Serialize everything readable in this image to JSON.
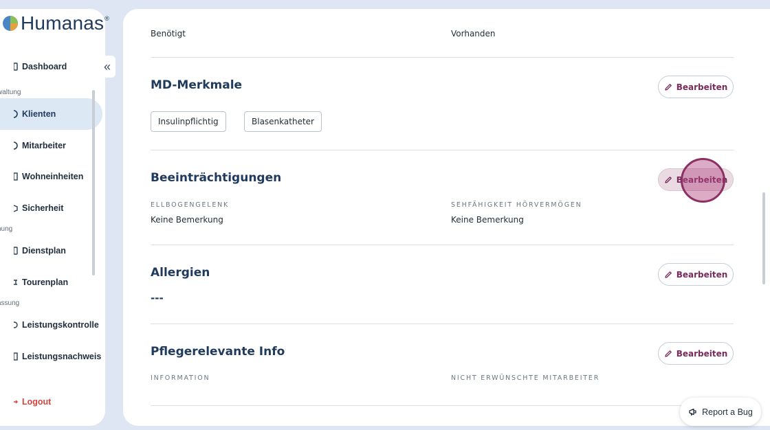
{
  "sidebar": {
    "logo_text": "Humanas",
    "logo_reg": "®",
    "collapse_glyph": "«",
    "sections": [
      "waltung",
      "nung",
      "assung"
    ],
    "items": [
      {
        "label": "Dashboard",
        "icon": "dashboard-icon"
      },
      {
        "label": "Klienten",
        "icon": "clients-icon",
        "active": true
      },
      {
        "label": "Mitarbeiter",
        "icon": "staff-icon"
      },
      {
        "label": "Wohneinheiten",
        "icon": "housing-icon"
      },
      {
        "label": "Sicherheit",
        "icon": "security-icon"
      },
      {
        "label": "Dienstplan",
        "icon": "schedule-icon"
      },
      {
        "label": "Tourenplan",
        "icon": "route-icon"
      },
      {
        "label": "Leistungskontrolle",
        "icon": "control-icon"
      },
      {
        "label": "Leistungsnachweis",
        "icon": "proof-icon"
      }
    ],
    "logout_label": "Logout"
  },
  "main": {
    "top_row": {
      "left": "Benötigt",
      "right": "Vorhanden"
    },
    "md_merkmale": {
      "title": "MD-Merkmale",
      "edit_label": "Bearbeiten",
      "tags": [
        "Insulinpflichtig",
        "Blasenkatheter"
      ]
    },
    "beeintraechtigungen": {
      "title": "Beeinträchtigungen",
      "edit_label": "Bearbeiten",
      "fields": [
        {
          "label": "ELLBOGENGELENK",
          "value": "Keine Bemerkung"
        },
        {
          "label": "SEHFÄHIGKEIT HÖRVERMÖGEN",
          "value": "Keine Bemerkung"
        }
      ]
    },
    "allergien": {
      "title": "Allergien",
      "edit_label": "Bearbeiten",
      "value": "---"
    },
    "pflegerelevante_info": {
      "title": "Pflegerelevante Info",
      "edit_label": "Bearbeiten",
      "fields": [
        {
          "label": "INFORMATION"
        },
        {
          "label": "NICHT ERWÜNSCHTE MITARBEITER"
        }
      ]
    }
  },
  "report_bug_label": "Report a Bug",
  "colors": {
    "background": "#dde6f2",
    "brand_navy": "#1f3a5c",
    "accent_plum": "#7a2a5a",
    "logout_red": "#d6453d",
    "active_nav": "#dde8f5"
  }
}
